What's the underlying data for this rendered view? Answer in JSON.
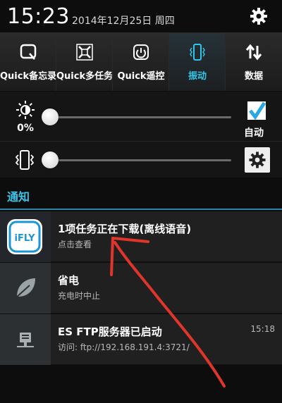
{
  "status": {
    "time": "15:23",
    "date": "2014年12月25日 周四"
  },
  "quick_settings": [
    {
      "name": "quick-memo",
      "label": "Quick备忘录",
      "icon": "memo-icon",
      "active": false
    },
    {
      "name": "quick-multitask",
      "label": "Quick多任务",
      "icon": "multitask-icon",
      "active": false
    },
    {
      "name": "quick-remote",
      "label": "Quick遥控",
      "icon": "remote-icon",
      "active": false
    },
    {
      "name": "vibrate",
      "label": "振动",
      "icon": "vibrate-icon",
      "active": true
    },
    {
      "name": "data",
      "label": "数据",
      "icon": "data-transfer-icon",
      "active": false
    }
  ],
  "brightness": {
    "percent_label": "0%",
    "level": 0,
    "auto_label": "自动",
    "auto_checked": true
  },
  "volume": {
    "level": 0
  },
  "notifications_header": "通知",
  "notifications": [
    {
      "app": "iFLY",
      "title": "1项任务正在下载(离线语音)",
      "subtitle": "点击查看",
      "time": ""
    },
    {
      "app": "leaf",
      "title": "省电",
      "subtitle": "充电时中止",
      "time": ""
    },
    {
      "app": "ftp",
      "title": "ES FTP服务器已启动",
      "subtitle": "访问: ftp://192.168.191.4:3721/",
      "time": "15:18"
    }
  ],
  "colors": {
    "accent": "#30c7e8",
    "annotation": "#e0352b"
  }
}
